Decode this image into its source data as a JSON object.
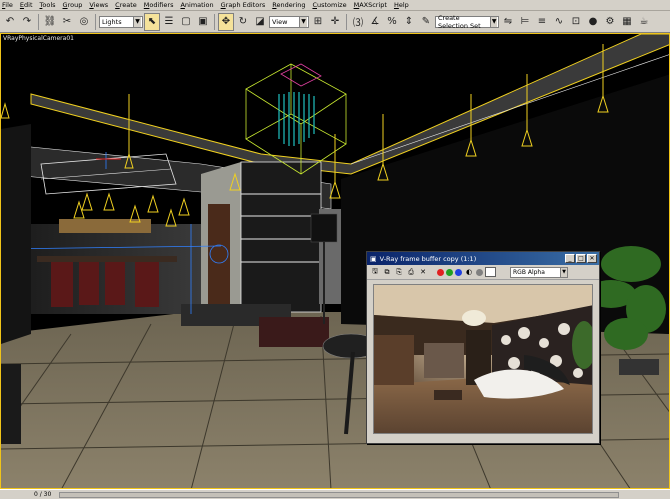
{
  "menu": [
    "File",
    "Edit",
    "Tools",
    "Group",
    "Views",
    "Create",
    "Modifiers",
    "Animation",
    "Graph Editors",
    "Rendering",
    "Customize",
    "MAXScript",
    "Help"
  ],
  "toolbar": {
    "filter_select": "Lights",
    "coord_select": "View",
    "selection_set": "Create Selection Set"
  },
  "viewport": {
    "label": "VRayPhysicalCamera01"
  },
  "vfb": {
    "title": "V-Ray frame buffer copy (1:1)",
    "channel": "RGB Alpha",
    "colors": {
      "red": "#e02020",
      "green": "#20a020",
      "blue": "#2040e0",
      "white": "#ffffff"
    }
  },
  "status": {
    "frames": "0 / 30"
  },
  "colors": {
    "wire_yellow": "#f0d020",
    "wire_white": "#e8e8e8",
    "chandelier_cyan": "#20c0c0",
    "title_blue": "#0a246a"
  }
}
